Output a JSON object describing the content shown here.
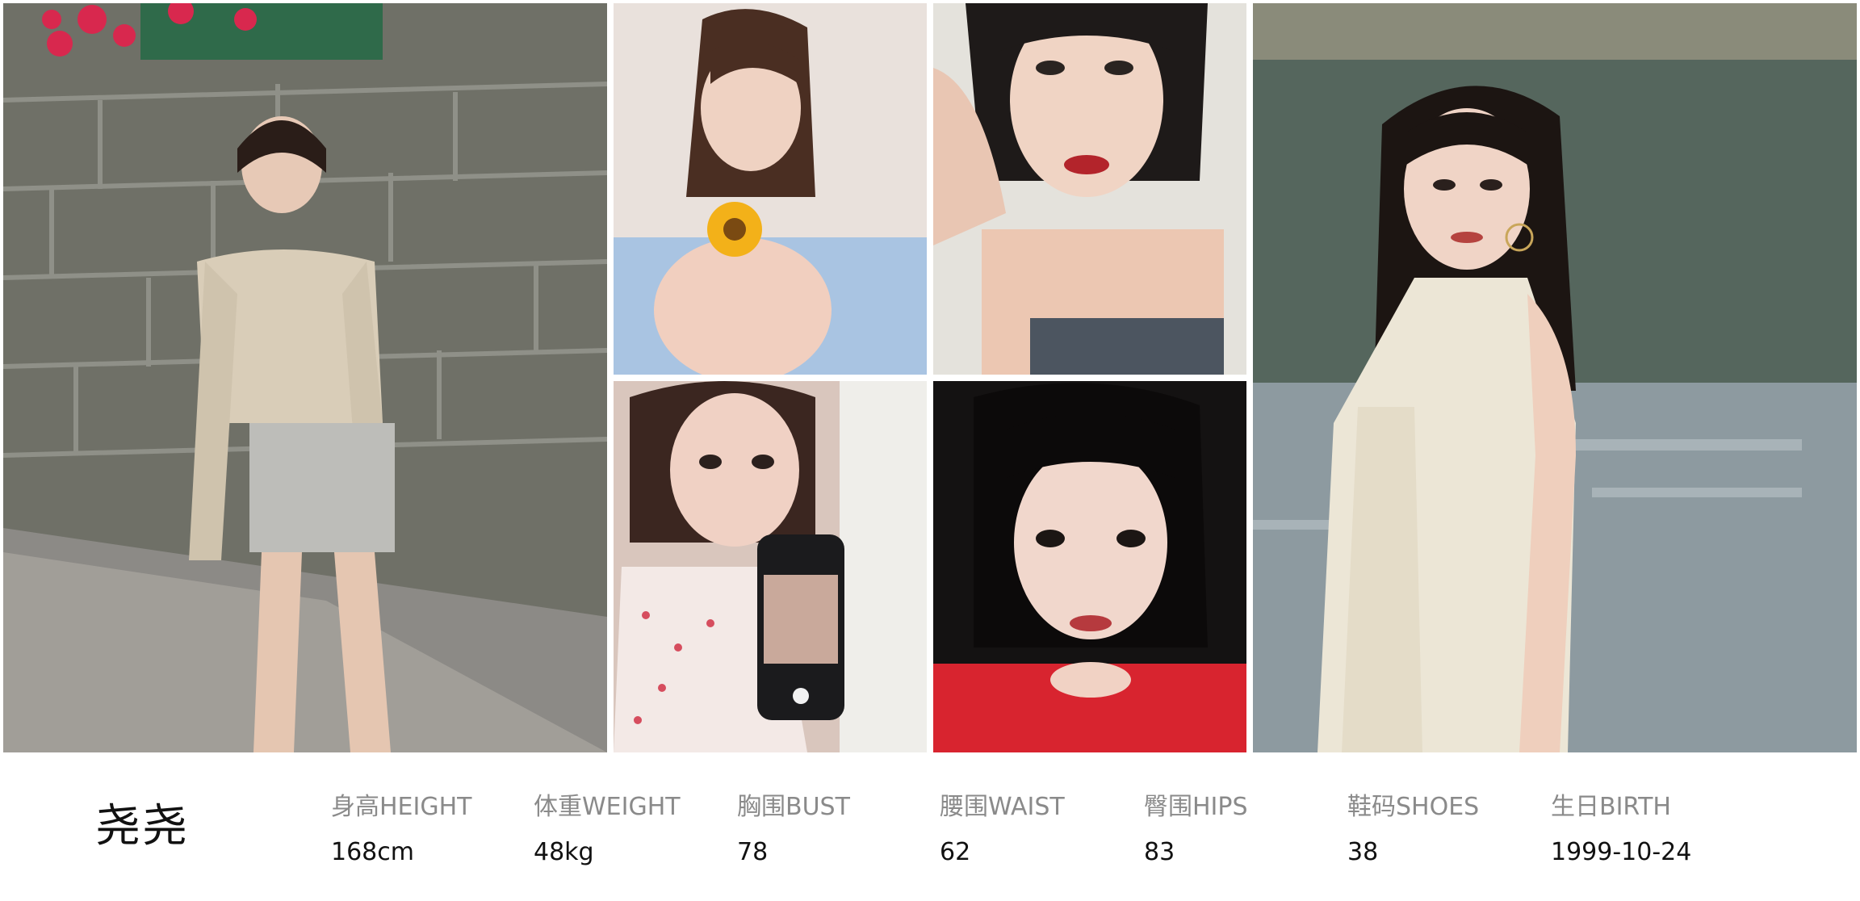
{
  "profile": {
    "name": "尧尧",
    "stats": [
      {
        "label": "身高HEIGHT",
        "value": "168cm"
      },
      {
        "label": "体重WEIGHT",
        "value": "48kg"
      },
      {
        "label": "胸围BUST",
        "value": "78"
      },
      {
        "label": "腰围WAIST",
        "value": "62"
      },
      {
        "label": "臀围HIPS",
        "value": "83"
      },
      {
        "label": "鞋码SHOES",
        "value": "38"
      },
      {
        "label": "生日BIRTH",
        "value": "1999-10-24"
      }
    ]
  }
}
